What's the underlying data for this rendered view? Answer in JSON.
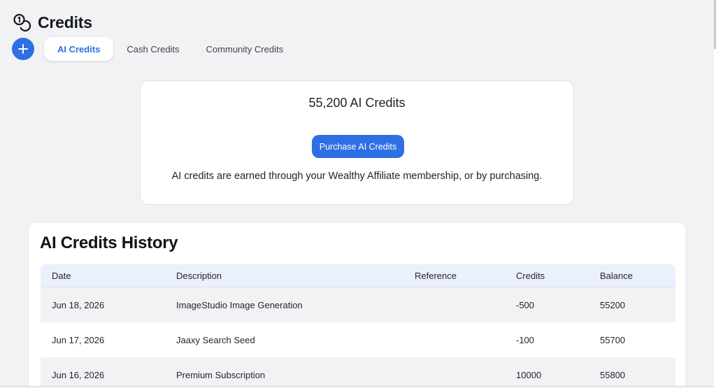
{
  "header": {
    "title": "Credits",
    "icon": "coins-icon"
  },
  "tabs": [
    {
      "label": "AI Credits",
      "active": true
    },
    {
      "label": "Cash Credits",
      "active": false
    },
    {
      "label": "Community Credits",
      "active": false
    }
  ],
  "summary": {
    "total": "55,200 AI Credits",
    "purchase_label": "Purchase AI Credits",
    "note": "AI credits are earned through your Wealthy Affiliate membership, or by purchasing."
  },
  "history": {
    "title": "AI Credits History",
    "columns": {
      "date": "Date",
      "description": "Description",
      "reference": "Reference",
      "credits": "Credits",
      "balance": "Balance"
    },
    "rows": [
      {
        "date": "Jun 18, 2026",
        "description": "ImageStudio Image Generation",
        "reference": "",
        "credits": "-500",
        "balance": "55200"
      },
      {
        "date": "Jun 17, 2026",
        "description": "Jaaxy Search Seed",
        "reference": "",
        "credits": "-100",
        "balance": "55700"
      },
      {
        "date": "Jun 16, 2026",
        "description": "Premium Subscription",
        "reference": "",
        "credits": "10000",
        "balance": "55800"
      }
    ]
  },
  "colors": {
    "accent": "#2f6fe4",
    "background": "#f1f2f4",
    "table_header": "#ebf0fd"
  }
}
